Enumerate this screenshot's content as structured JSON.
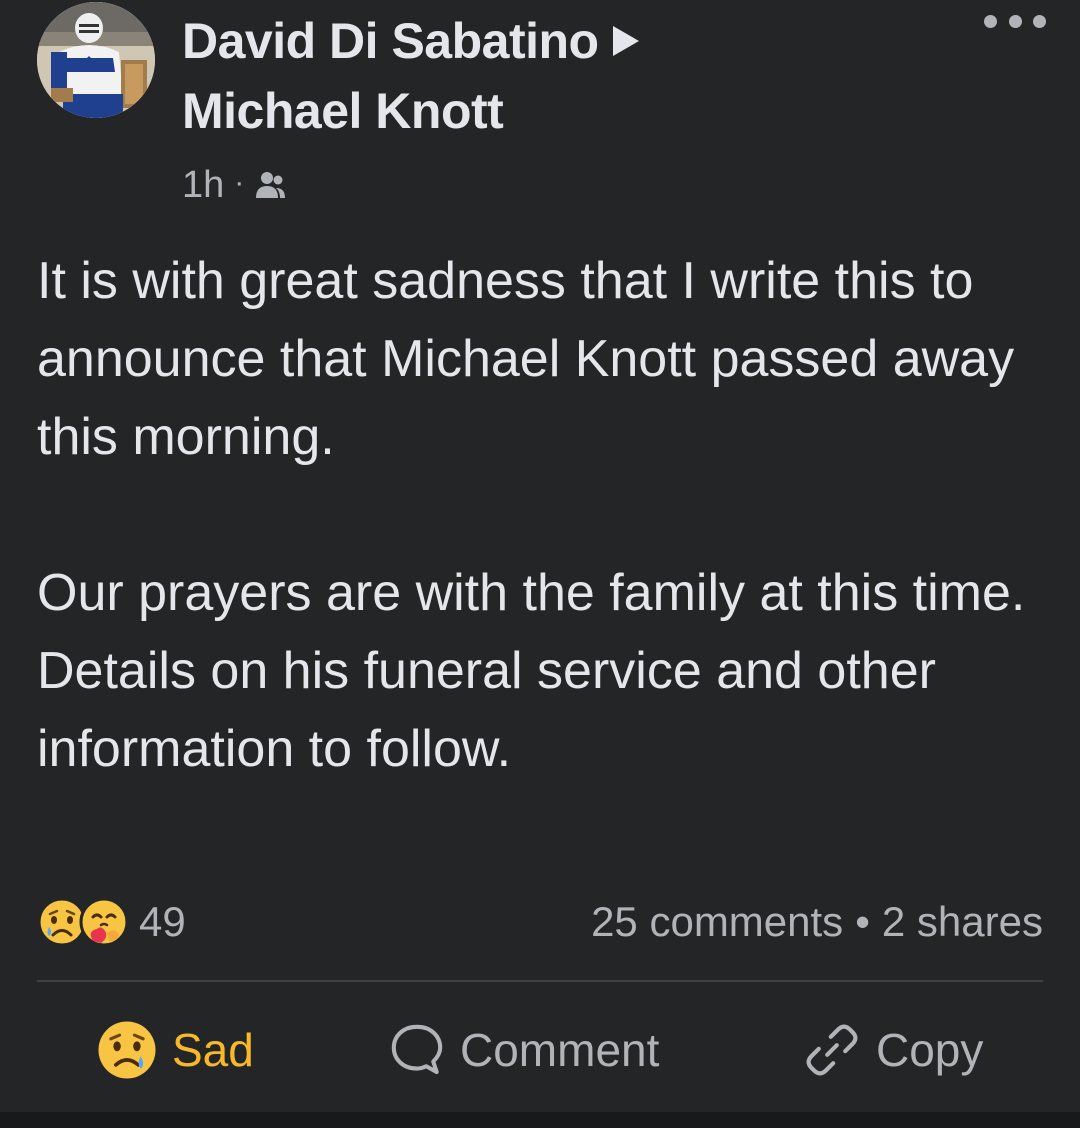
{
  "post": {
    "author": "David Di Sabatino",
    "recipient": "Michael Knott",
    "time": "1h",
    "separator": "·",
    "audience_icon": "friends-icon",
    "paragraphs": [
      "It is with great sadness that I write this to announce that Michael Knott passed away this morning.",
      "Our prayers are with the family at this time.",
      "Details on his funeral service and other information to follow."
    ]
  },
  "stats": {
    "reaction_icons": [
      "sad-emoji-icon",
      "care-emoji-icon"
    ],
    "reaction_count": "49",
    "comments": "25 comments",
    "bullet": "•",
    "shares": "2 shares"
  },
  "actions": {
    "sad_label": "Sad",
    "comment_label": "Comment",
    "copy_label": "Copy"
  },
  "colors": {
    "background": "#242526",
    "text": "#e4e6eb",
    "secondary_text": "#b0b3b8",
    "sad_accent": "#f7b928",
    "divider": "#3e4042"
  }
}
